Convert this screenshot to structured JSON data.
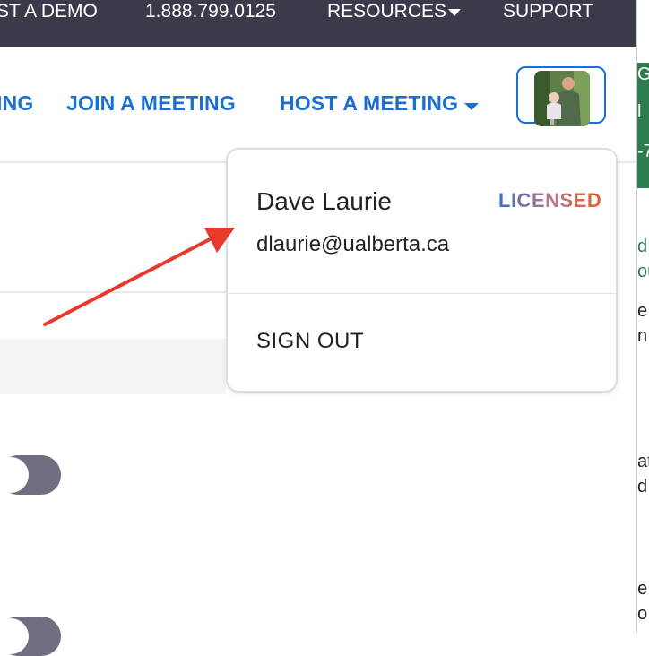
{
  "topbar": {
    "demo": "ST A DEMO",
    "phone": "1.888.799.0125",
    "resources": "RESOURCES",
    "support": "SUPPORT"
  },
  "nav": {
    "left_cut": "ING",
    "join": "JOIN A MEETING",
    "host": "HOST A MEETING"
  },
  "dropdown": {
    "name": "Dave Laurie",
    "badge": "LICENSED",
    "email": "dlaurie@ualberta.ca",
    "sign_out": "SIGN OUT"
  },
  "strip": {
    "g": "G",
    "l": "l",
    "dash": "-7",
    "d": "d",
    "ou": "ou",
    "e1": "e",
    "n1": "n",
    "at": "at",
    "d2": "d",
    "e2": "e",
    "o": "o"
  },
  "colors": {
    "topbar": "#3a3b4a",
    "link": "#1a6fd3",
    "annotation_arrow": "#e8392b",
    "toggle": "#6e6f80"
  }
}
